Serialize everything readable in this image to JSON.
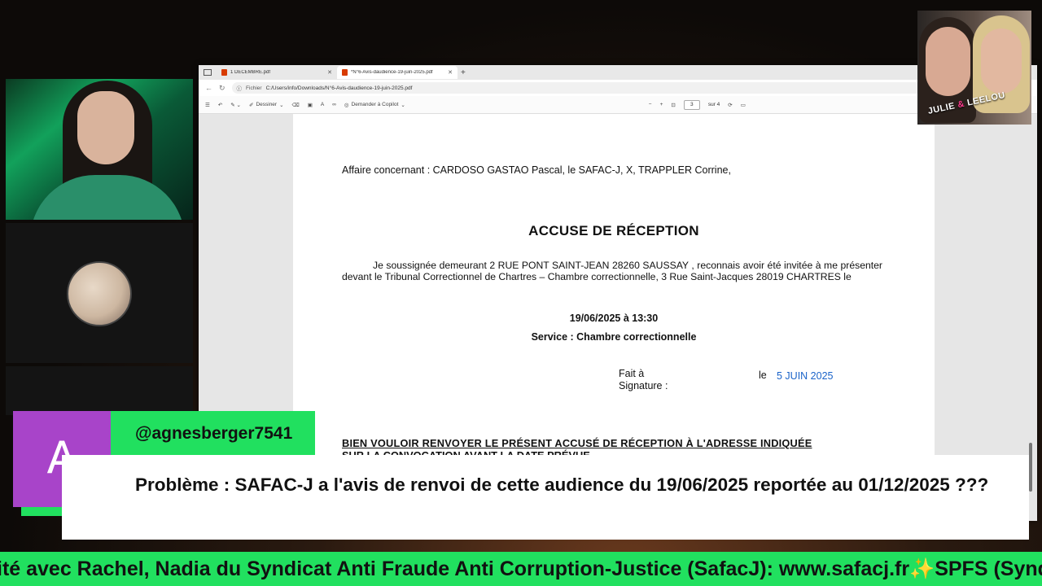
{
  "browser": {
    "tabs": [
      {
        "title": "1 DECEMBRE.pdf",
        "active": false
      },
      {
        "title": "*N°6-Avis-daudience-19-juin-2025.pdf",
        "active": true
      }
    ],
    "address": {
      "scheme_label": "Fichier",
      "url": "C:/Users/info/Downloads/N°6-Avis-daudience-19-juin-2025.pdf"
    },
    "pdf_toolbar": {
      "draw_label": "Dessiner",
      "copilot_label": "Demander à Copilot",
      "page_current": "3",
      "page_total": "sur 4"
    }
  },
  "document": {
    "affaire": "Affaire concernant : CARDOSO GASTAO Pascal, le SAFAC-J, X, TRAPPLER Corrine,",
    "heading": "ACCUSE DE RÉCEPTION",
    "paragraph": "Je soussignée demeurant 2 RUE PONT SAINT-JEAN 28260 SAUSSAY , reconnais avoir été invitée à me présenter devant le Tribunal Correctionnel de Chartres – Chambre correctionnelle, 3 Rue Saint-Jacques 28019 CHARTRES le",
    "datetime": "19/06/2025 à 13:30",
    "service": "Service : Chambre correctionnelle",
    "fait_a": "Fait à",
    "signature": "Signature :",
    "le": "le",
    "signed_date": "5 JUIN 2025",
    "bien_vouloir": "BIEN VOULOIR RENVOYER LE PRÉSENT ACCUSÉ DE RÉCEPTION À L'ADRESSE INDIQUÉE",
    "sur_la": "SUR LA CONVOCATION AVANT LA DATE PRÉVUE"
  },
  "webcams": {
    "right_label_a": "JULIE ",
    "right_label_amp": "&",
    "right_label_b": " LEELOU"
  },
  "comment": {
    "avatar_letter": "A",
    "username": "@agnesberger7541",
    "text": "Problème : SAFAC-J a l'avis de renvoi de cette audience du 19/06/2025 reportée au 01/12/2025 ???"
  },
  "ticker": {
    "text": "ité avec Rachel, Nadia du Syndicat Anti Fraude Anti Corruption-Justice (SafacJ): www.safacj.fr✨SPFS (Synd"
  },
  "colors": {
    "green": "#21e05f",
    "avatar_purple": "#a844c9",
    "date_blue": "#1a63c9"
  }
}
